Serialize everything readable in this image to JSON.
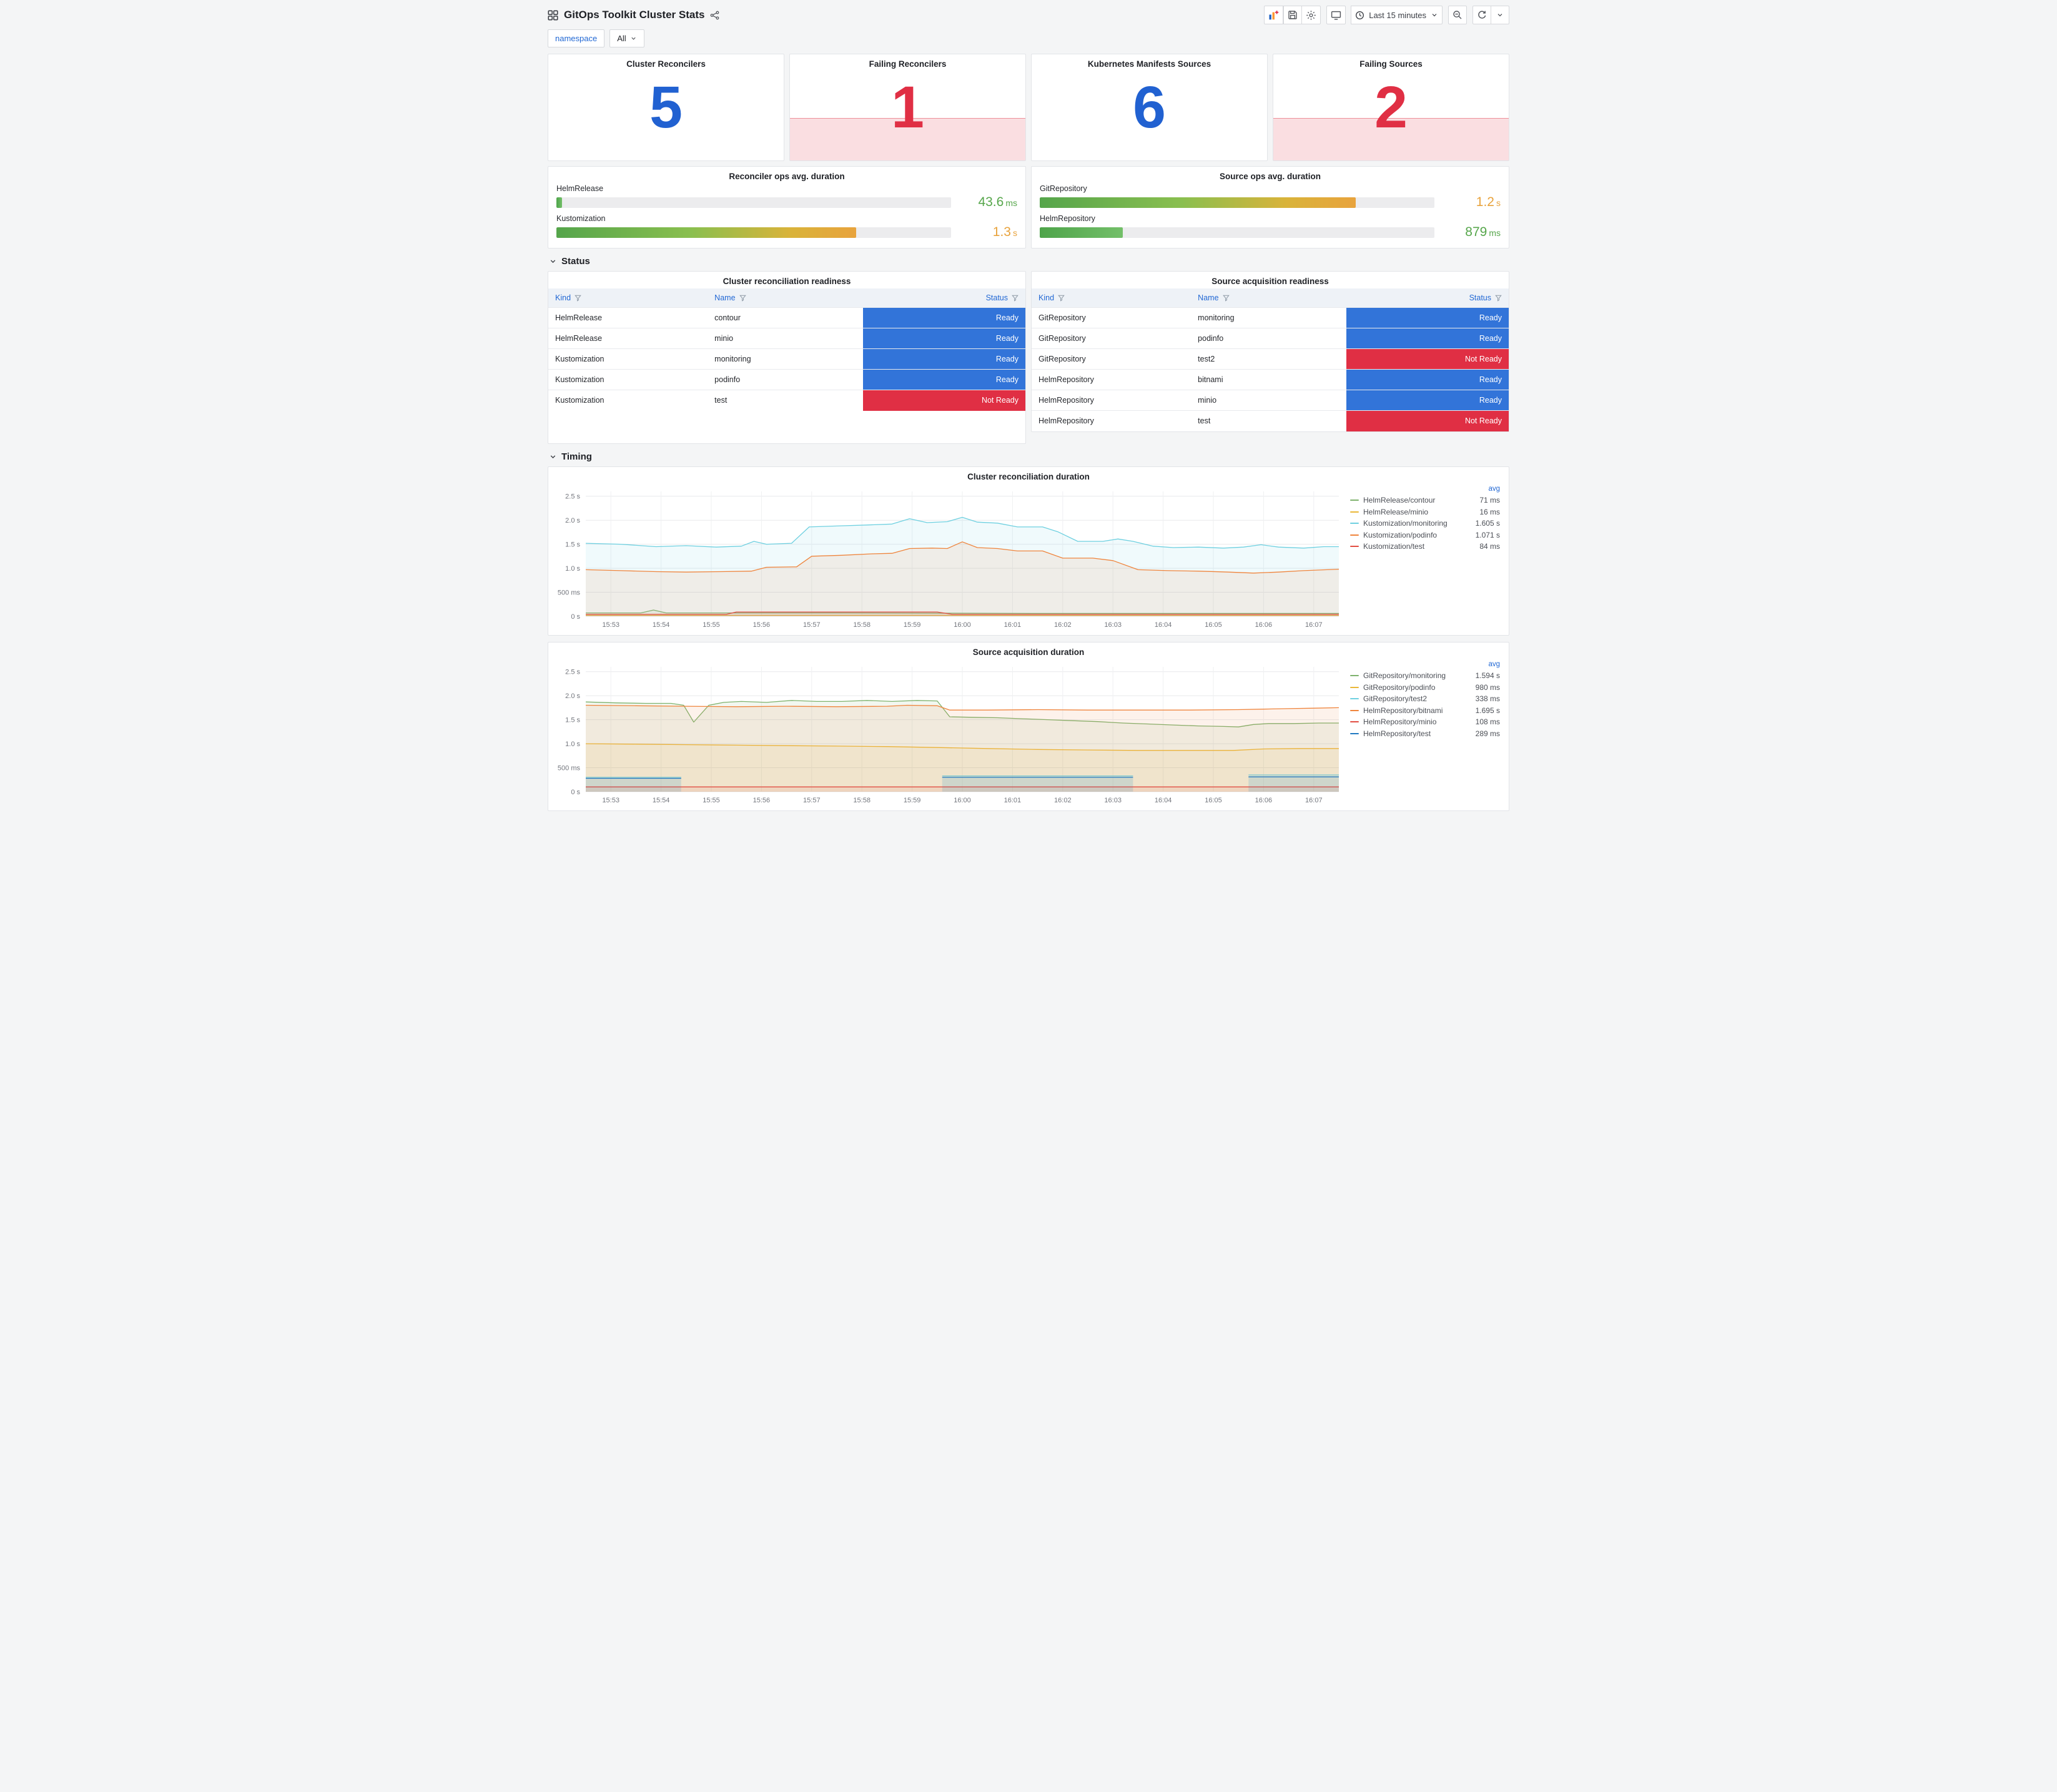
{
  "colors": {
    "stat_ok": "#2161d1",
    "stat_alert": "#e02f44",
    "ready": "#3274d9",
    "not_ready": "#e02f44",
    "green_value": "#56a64b",
    "orange_value": "#e8a33d",
    "link_blue": "#2268d4"
  },
  "header": {
    "title": "GitOps Toolkit Cluster Stats",
    "time_range_label": "Last 15 minutes"
  },
  "filter": {
    "label": "namespace",
    "value": "All"
  },
  "stats": [
    {
      "title": "Cluster Reconcilers",
      "value": "5",
      "state": "ok"
    },
    {
      "title": "Failing Reconcilers",
      "value": "1",
      "state": "alert"
    },
    {
      "title": "Kubernetes Manifests Sources",
      "value": "6",
      "state": "ok"
    },
    {
      "title": "Failing Sources",
      "value": "2",
      "state": "alert"
    }
  ],
  "gauges": [
    {
      "title": "Reconciler ops avg. duration",
      "rows": [
        {
          "label": "HelmRelease",
          "value": "43.6",
          "unit": "ms",
          "pct": 1.5,
          "tone": "green"
        },
        {
          "label": "Kustomization",
          "value": "1.3",
          "unit": "s",
          "pct": 76,
          "tone": "orange"
        }
      ]
    },
    {
      "title": "Source ops avg. duration",
      "rows": [
        {
          "label": "GitRepository",
          "value": "1.2",
          "unit": "s",
          "pct": 80,
          "tone": "orange"
        },
        {
          "label": "HelmRepository",
          "value": "879",
          "unit": "ms",
          "pct": 21,
          "tone": "green"
        }
      ]
    }
  ],
  "sections": {
    "status": "Status",
    "timing": "Timing"
  },
  "tables": [
    {
      "title": "Cluster reconciliation readiness",
      "columns": [
        "Kind",
        "Name",
        "Status"
      ],
      "rows": [
        [
          "HelmRelease",
          "contour",
          "Ready"
        ],
        [
          "HelmRelease",
          "minio",
          "Ready"
        ],
        [
          "Kustomization",
          "monitoring",
          "Ready"
        ],
        [
          "Kustomization",
          "podinfo",
          "Ready"
        ],
        [
          "Kustomization",
          "test",
          "Not Ready"
        ]
      ]
    },
    {
      "title": "Source acquisition readiness",
      "columns": [
        "Kind",
        "Name",
        "Status"
      ],
      "rows": [
        [
          "GitRepository",
          "monitoring",
          "Ready"
        ],
        [
          "GitRepository",
          "podinfo",
          "Ready"
        ],
        [
          "GitRepository",
          "test2",
          "Not Ready"
        ],
        [
          "HelmRepository",
          "bitnami",
          "Ready"
        ],
        [
          "HelmRepository",
          "minio",
          "Ready"
        ],
        [
          "HelmRepository",
          "test",
          "Not Ready"
        ]
      ]
    }
  ],
  "chart_data": [
    {
      "type": "area",
      "title": "Cluster reconciliation duration",
      "legend_header": "avg",
      "legend_position": "right",
      "grid": true,
      "ylim": [
        0,
        2.6
      ],
      "yticks": [
        {
          "v": 0,
          "label": "0 s"
        },
        {
          "v": 0.5,
          "label": "500 ms"
        },
        {
          "v": 1,
          "label": "1.0 s"
        },
        {
          "v": 1.5,
          "label": "1.5 s"
        },
        {
          "v": 2,
          "label": "2.0 s"
        },
        {
          "v": 2.5,
          "label": "2.5 s"
        }
      ],
      "xticks": [
        "15:53",
        "15:54",
        "15:55",
        "15:56",
        "15:57",
        "15:58",
        "15:59",
        "16:00",
        "16:01",
        "16:02",
        "16:03",
        "16:04",
        "16:05",
        "16:06",
        "16:07"
      ],
      "series": [
        {
          "name": "HelmRelease/contour",
          "avg": "71 ms",
          "color": "#7EB26D",
          "points": [
            [
              0,
              0.07
            ],
            [
              1.1,
              0.07
            ],
            [
              1.35,
              0.13
            ],
            [
              1.6,
              0.07
            ],
            [
              5,
              0.07
            ],
            [
              9,
              0.06
            ],
            [
              15,
              0.06
            ]
          ]
        },
        {
          "name": "HelmRelease/minio",
          "avg": "16 ms",
          "color": "#EAB839",
          "points": [
            [
              0,
              0.02
            ],
            [
              15,
              0.02
            ]
          ]
        },
        {
          "name": "Kustomization/monitoring",
          "avg": "1.605 s",
          "color": "#6ED0E0",
          "points": [
            [
              0,
              1.52
            ],
            [
              0.7,
              1.5
            ],
            [
              1.4,
              1.45
            ],
            [
              2,
              1.47
            ],
            [
              2.6,
              1.44
            ],
            [
              3.1,
              1.46
            ],
            [
              3.35,
              1.56
            ],
            [
              3.6,
              1.5
            ],
            [
              4.1,
              1.52
            ],
            [
              4.45,
              1.86
            ],
            [
              5,
              1.88
            ],
            [
              5.6,
              1.9
            ],
            [
              6.1,
              1.92
            ],
            [
              6.45,
              2.03
            ],
            [
              6.8,
              1.95
            ],
            [
              7.2,
              1.97
            ],
            [
              7.5,
              2.06
            ],
            [
              7.8,
              1.96
            ],
            [
              8.2,
              1.94
            ],
            [
              8.6,
              1.86
            ],
            [
              9.1,
              1.86
            ],
            [
              9.4,
              1.76
            ],
            [
              9.8,
              1.56
            ],
            [
              10.3,
              1.56
            ],
            [
              10.6,
              1.61
            ],
            [
              10.9,
              1.56
            ],
            [
              11.3,
              1.46
            ],
            [
              11.7,
              1.43
            ],
            [
              12.2,
              1.44
            ],
            [
              12.7,
              1.42
            ],
            [
              13.1,
              1.44
            ],
            [
              13.45,
              1.49
            ],
            [
              13.8,
              1.44
            ],
            [
              14.3,
              1.42
            ],
            [
              14.7,
              1.45
            ],
            [
              15,
              1.45
            ]
          ]
        },
        {
          "name": "Kustomization/podinfo",
          "avg": "1.071 s",
          "color": "#EF843C",
          "points": [
            [
              0,
              0.97
            ],
            [
              0.7,
              0.95
            ],
            [
              1.4,
              0.93
            ],
            [
              2,
              0.92
            ],
            [
              2.7,
              0.93
            ],
            [
              3.3,
              0.94
            ],
            [
              3.6,
              1.02
            ],
            [
              4.2,
              1.03
            ],
            [
              4.5,
              1.25
            ],
            [
              5.1,
              1.27
            ],
            [
              5.7,
              1.3
            ],
            [
              6.1,
              1.31
            ],
            [
              6.45,
              1.41
            ],
            [
              6.9,
              1.42
            ],
            [
              7.2,
              1.41
            ],
            [
              7.5,
              1.55
            ],
            [
              7.8,
              1.43
            ],
            [
              8.2,
              1.41
            ],
            [
              8.6,
              1.36
            ],
            [
              9.1,
              1.36
            ],
            [
              9.5,
              1.21
            ],
            [
              10.1,
              1.21
            ],
            [
              10.5,
              1.16
            ],
            [
              11,
              0.97
            ],
            [
              11.6,
              0.95
            ],
            [
              12.2,
              0.94
            ],
            [
              12.8,
              0.92
            ],
            [
              13.3,
              0.9
            ],
            [
              13.8,
              0.92
            ],
            [
              14.3,
              0.95
            ],
            [
              15,
              0.98
            ]
          ]
        },
        {
          "name": "Kustomization/test",
          "avg": "84 ms",
          "color": "#E24D42",
          "points": [
            [
              0,
              0.04
            ],
            [
              2.8,
              0.04
            ],
            [
              3,
              0.09
            ],
            [
              7,
              0.09
            ],
            [
              7.3,
              0.04
            ],
            [
              15,
              0.04
            ]
          ]
        }
      ]
    },
    {
      "type": "area",
      "title": "Source acquisition duration",
      "legend_header": "avg",
      "legend_position": "right",
      "grid": true,
      "ylim": [
        0,
        2.6
      ],
      "yticks": [
        {
          "v": 0,
          "label": "0 s"
        },
        {
          "v": 0.5,
          "label": "500 ms"
        },
        {
          "v": 1,
          "label": "1.0 s"
        },
        {
          "v": 1.5,
          "label": "1.5 s"
        },
        {
          "v": 2,
          "label": "2.0 s"
        },
        {
          "v": 2.5,
          "label": "2.5 s"
        }
      ],
      "xticks": [
        "15:53",
        "15:54",
        "15:55",
        "15:56",
        "15:57",
        "15:58",
        "15:59",
        "16:00",
        "16:01",
        "16:02",
        "16:03",
        "16:04",
        "16:05",
        "16:06",
        "16:07"
      ],
      "series": [
        {
          "name": "GitRepository/monitoring",
          "avg": "1.594 s",
          "color": "#7EB26D",
          "points": [
            [
              0,
              1.87
            ],
            [
              0.6,
              1.85
            ],
            [
              1.2,
              1.84
            ],
            [
              1.7,
              1.84
            ],
            [
              1.95,
              1.8
            ],
            [
              2.15,
              1.45
            ],
            [
              2.45,
              1.8
            ],
            [
              2.75,
              1.86
            ],
            [
              3.1,
              1.88
            ],
            [
              3.6,
              1.86
            ],
            [
              4.1,
              1.9
            ],
            [
              4.6,
              1.88
            ],
            [
              5.1,
              1.88
            ],
            [
              5.6,
              1.9
            ],
            [
              6.1,
              1.88
            ],
            [
              6.6,
              1.9
            ],
            [
              7,
              1.89
            ],
            [
              7.25,
              1.56
            ],
            [
              7.7,
              1.55
            ],
            [
              8.2,
              1.54
            ],
            [
              8.7,
              1.52
            ],
            [
              9.2,
              1.5
            ],
            [
              9.7,
              1.48
            ],
            [
              10.2,
              1.46
            ],
            [
              10.7,
              1.43
            ],
            [
              11.2,
              1.41
            ],
            [
              11.7,
              1.39
            ],
            [
              12.2,
              1.37
            ],
            [
              12.7,
              1.36
            ],
            [
              13,
              1.35
            ],
            [
              13.3,
              1.4
            ],
            [
              13.6,
              1.42
            ],
            [
              14.1,
              1.42
            ],
            [
              14.6,
              1.43
            ],
            [
              15,
              1.43
            ]
          ]
        },
        {
          "name": "GitRepository/podinfo",
          "avg": "980 ms",
          "color": "#EAB839",
          "points": [
            [
              0,
              1
            ],
            [
              1,
              0.99
            ],
            [
              2,
              0.98
            ],
            [
              3,
              0.97
            ],
            [
              4,
              0.96
            ],
            [
              5,
              0.95
            ],
            [
              6,
              0.94
            ],
            [
              7,
              0.92
            ],
            [
              8,
              0.9
            ],
            [
              9,
              0.88
            ],
            [
              10,
              0.87
            ],
            [
              11,
              0.86
            ],
            [
              12,
              0.86
            ],
            [
              12.9,
              0.86
            ],
            [
              13.5,
              0.89
            ],
            [
              14.2,
              0.9
            ],
            [
              15,
              0.9
            ]
          ]
        },
        {
          "name": "GitRepository/test2",
          "avg": "338 ms",
          "color": "#6ED0E0",
          "points": [
            [
              0,
              0.3
            ],
            [
              1.9,
              0.3
            ],
            [
              2,
              null
            ],
            [
              7.1,
              0.33
            ],
            [
              10.9,
              0.33
            ],
            [
              11,
              null
            ],
            [
              13.2,
              0.35
            ],
            [
              15,
              0.35
            ]
          ]
        },
        {
          "name": "HelmRepository/bitnami",
          "avg": "1.695 s",
          "color": "#EF843C",
          "points": [
            [
              0,
              1.8
            ],
            [
              1,
              1.79
            ],
            [
              2,
              1.78
            ],
            [
              3,
              1.77
            ],
            [
              4,
              1.78
            ],
            [
              5,
              1.77
            ],
            [
              6,
              1.78
            ],
            [
              6.4,
              1.8
            ],
            [
              7,
              1.79
            ],
            [
              7.25,
              1.7
            ],
            [
              8,
              1.7
            ],
            [
              9,
              1.71
            ],
            [
              10,
              1.7
            ],
            [
              11,
              1.7
            ],
            [
              12,
              1.7
            ],
            [
              13,
              1.71
            ],
            [
              13.5,
              1.72
            ],
            [
              14,
              1.73
            ],
            [
              14.5,
              1.74
            ],
            [
              15,
              1.75
            ]
          ]
        },
        {
          "name": "HelmRepository/minio",
          "avg": "108 ms",
          "color": "#E24D42",
          "points": [
            [
              0,
              0.1
            ],
            [
              15,
              0.1
            ]
          ]
        },
        {
          "name": "HelmRepository/test",
          "avg": "289 ms",
          "color": "#1F78C1",
          "points": [
            [
              0,
              0.28
            ],
            [
              1.9,
              0.28
            ],
            [
              2,
              null
            ],
            [
              7.1,
              0.3
            ],
            [
              10.9,
              0.3
            ],
            [
              11,
              null
            ],
            [
              13.2,
              0.31
            ],
            [
              15,
              0.31
            ]
          ]
        }
      ]
    }
  ]
}
